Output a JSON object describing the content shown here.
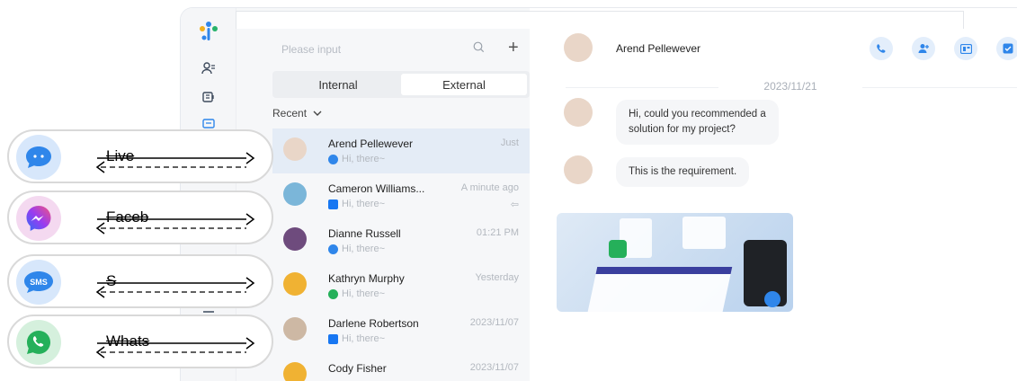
{
  "search": {
    "placeholder": "Please input"
  },
  "tabs": {
    "internal": "Internal",
    "external": "External"
  },
  "recent_label": "Recent",
  "conversations": [
    {
      "name": "Arend Pellewever",
      "time": "Just",
      "preview": "Hi,  there~",
      "channel": "livechat"
    },
    {
      "name": "Cameron Williams...",
      "time": "A minute ago",
      "preview": "Hi,  there~",
      "channel": "facebook"
    },
    {
      "name": "Dianne Russell",
      "time": "01:21 PM",
      "preview": "Hi,  there~",
      "channel": "sms"
    },
    {
      "name": "Kathryn Murphy",
      "time": "Yesterday",
      "preview": "Hi,  there~",
      "channel": "whatsapp"
    },
    {
      "name": "Darlene Robertson",
      "time": "2023/11/07",
      "preview": "Hi,  there~",
      "channel": "facebook"
    },
    {
      "name": "Cody Fisher",
      "time": "2023/11/07",
      "preview": "",
      "channel": "livechat"
    }
  ],
  "chat": {
    "contact_name": "Arend Pellewever",
    "date": "2023/11/21",
    "messages": [
      {
        "text_line1": "Hi, could you recommended a",
        "text_line2": "solution for my project?"
      },
      {
        "text": "This is the requirement."
      }
    ]
  },
  "badges": [
    {
      "label": "Live",
      "icon": "livechat-icon",
      "color": "#2f86ea"
    },
    {
      "label": "Faceb",
      "icon": "messenger-icon",
      "color": "#7b4ff0"
    },
    {
      "label": "S",
      "icon": "sms-icon",
      "color": "#2f86ea"
    },
    {
      "label": "Whats",
      "icon": "whatsapp-icon",
      "color": "#25b05a"
    }
  ],
  "colors": {
    "accent": "#2f86ea",
    "selected_row": "#e4ecf6"
  }
}
